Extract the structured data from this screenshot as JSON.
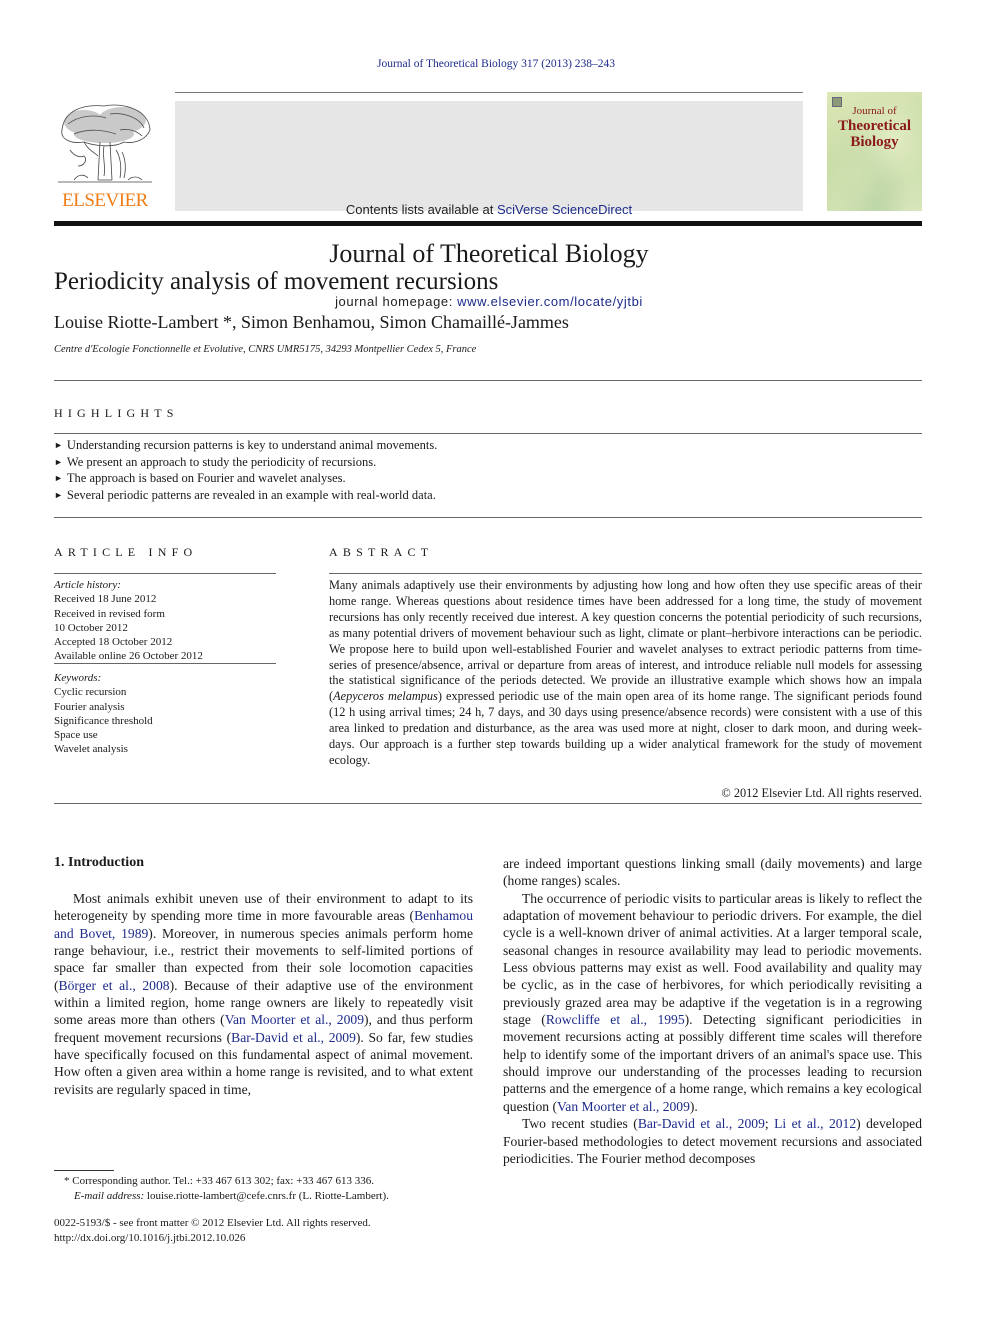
{
  "header": {
    "citation": "Journal of Theoretical Biology 317 (2013) 238–243",
    "contents_prefix": "Contents lists available at ",
    "contents_link": "SciVerse ScienceDirect",
    "journal_name": "Journal of Theoretical Biology",
    "homepage_prefix": "journal homepage: ",
    "homepage_link": "www.elsevier.com/locate/yjtbi",
    "publisher_logo_text": "ELSEVIER",
    "publisher_logo_icon": "elsevier-tree-icon",
    "cover": {
      "line1": "Journal of",
      "line2": "Theoretical",
      "line3": "Biology"
    },
    "colors": {
      "link": "#1d2b8a",
      "elsevier_orange": "#f07d18",
      "cover_title": "#8b1a1a",
      "banner_bg": "#e6e6e6"
    }
  },
  "article": {
    "title": "Periodicity analysis of movement recursions",
    "authors": "Louise Riotte-Lambert *, Simon Benhamou, Simon Chamaillé-Jammes",
    "affiliation": "Centre d'Ecologie Fonctionnelle et Evolutive, CNRS UMR5175, 34293 Montpellier Cedex 5, France"
  },
  "highlights": {
    "heading": "HIGHLIGHTS",
    "items": [
      "Understanding recursion patterns is key to understand animal movements.",
      "We present an approach to study the periodicity of recursions.",
      "The approach is based on Fourier and wavelet analyses.",
      "Several periodic patterns are revealed in an example with real-world data."
    ]
  },
  "article_info": {
    "heading": "ARTICLE INFO",
    "history_label": "Article history:",
    "history": [
      "Received 18 June 2012",
      "Received in revised form",
      "10 October 2012",
      "Accepted 18 October 2012",
      "Available online 26 October 2012"
    ],
    "keywords_label": "Keywords:",
    "keywords": [
      "Cyclic recursion",
      "Fourier analysis",
      "Significance threshold",
      "Space use",
      "Wavelet analysis"
    ]
  },
  "abstract": {
    "heading": "ABSTRACT",
    "part1": "Many animals adaptively use their environments by adjusting how long and how often they use specific areas of their home range. Whereas questions about residence times have been addressed for a long time, the study of movement recursions has only recently received due interest. A key question concerns the potential periodicity of such recursions, as many potential drivers of movement behaviour such as light, climate or plant–herbivore interactions can be periodic. We propose here to build upon well-established Fourier and wavelet analyses to extract periodic patterns from time-series of presence/absence, arrival or departure from areas of interest, and introduce reliable null models for assessing the statistical significance of the periods detected. We provide an illustrative example which shows how an impala (",
    "species": "Aepyceros melampus",
    "part2": ") expressed periodic use of the main open area of its home range. The significant periods found (12 h using arrival times; 24 h, 7 days, and 30 days using presence/absence records) were consistent with a use of this area linked to predation and disturbance, as the area was used more at night, closer to dark moon, and during week-days. Our approach is a further step towards building up a wider analytical framework for the study of movement ecology.",
    "copyright": "© 2012 Elsevier Ltd. All rights reserved."
  },
  "introduction": {
    "heading": "1.  Introduction",
    "left_p1": [
      "Most animals exhibit uneven use of their environment to adapt to its heterogeneity by spending more time in more favourable areas (",
      "Benhamou and Bovet, 1989",
      "). Moreover, in numerous species animals perform home range behaviour, i.e., restrict their movements to self-limited portions of space far smaller than expected from their sole locomotion capacities (",
      "Börger et al., 2008",
      "). Because of their adaptive use of the environment within a limited region, home range owners are likely to repeatedly visit some areas more than others (",
      "Van Moorter et al., 2009",
      "), and thus perform frequent movement recursions (",
      "Bar-David et al., 2009",
      "). So far, few studies have specifically focused on this fundamental aspect of animal movement. How often a given area within a home range is revisited, and to what extent revisits are regularly spaced in time,"
    ],
    "right_p0": "are indeed important questions linking small (daily movements) and large (home ranges) scales.",
    "right_p1": [
      "The occurrence of periodic visits to particular areas is likely to reflect the adaptation of movement behaviour to periodic drivers. For example, the diel cycle is a well-known driver of animal activities. At a larger temporal scale, seasonal changes in resource availability may lead to periodic movements. Less obvious patterns may exist as well. Food availability and quality may be cyclic, as in the case of herbivores, for which periodically revisiting a previously grazed area may be adaptive if the vegetation is in a regrowing stage (",
      "Rowcliffe et al., 1995",
      "). Detecting significant periodicities in movement recursions acting at possibly different time scales will therefore help to identify some of the important drivers of an animal's space use. This should improve our understanding of the processes leading to recursion patterns and the emergence of a home range, which remains a key ecological question (",
      "Van Moorter et al., 2009",
      ")."
    ],
    "right_p2": [
      "Two recent studies (",
      "Bar-David et al., 2009",
      "; ",
      "Li et al., 2012",
      ") developed Fourier-based methodologies to detect movement recursions and associated periodicities. The Fourier method decomposes"
    ]
  },
  "footnote": {
    "corresponding": "* Corresponding author. Tel.: +33 467 613 302; fax: +33 467 613 336.",
    "email_label": "E-mail address: ",
    "email": "louise.riotte-lambert@cefe.cnrs.fr",
    "email_suffix": " (L. Riotte-Lambert).",
    "front_matter": "0022-5193/$ - see front matter © 2012 Elsevier Ltd. All rights reserved.",
    "doi": "http://dx.doi.org/10.1016/j.jtbi.2012.10.026"
  }
}
